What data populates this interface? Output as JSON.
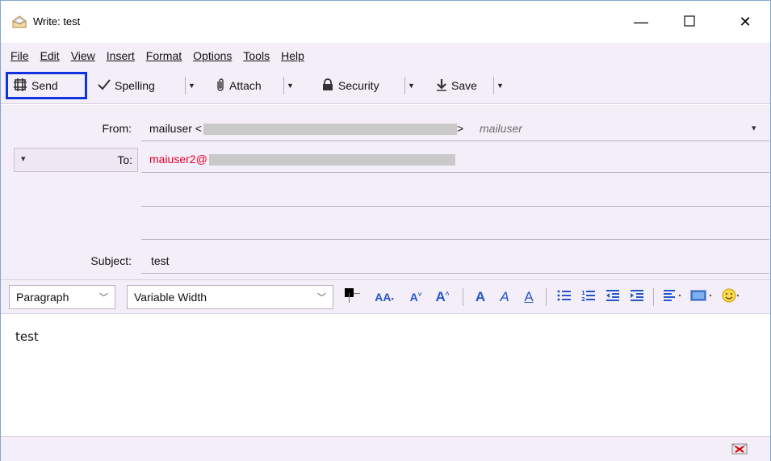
{
  "window": {
    "title": "Write: test",
    "min_glyph": "—",
    "max_glyph": "☐",
    "close_glyph": "✕"
  },
  "menu": [
    {
      "label": "File",
      "accel": "F"
    },
    {
      "label": "Edit",
      "accel": "E"
    },
    {
      "label": "View",
      "accel": "V"
    },
    {
      "label": "Insert",
      "accel": "I"
    },
    {
      "label": "Format",
      "accel": "o"
    },
    {
      "label": "Options",
      "accel": "p"
    },
    {
      "label": "Tools",
      "accel": "T"
    },
    {
      "label": "Help",
      "accel": "H"
    }
  ],
  "toolbar": {
    "send_label": "Send",
    "spelling_label": "Spelling",
    "attach_label": "Attach",
    "security_label": "Security",
    "save_label": "Save"
  },
  "header": {
    "from_label": "From:",
    "from_name": "mailuser <",
    "from_suffix": ">",
    "from_identity": "mailuser",
    "to_label": "To:",
    "to_value": "maiuser2@",
    "subject_label": "Subject:",
    "subject_value": "test"
  },
  "format": {
    "paragraph_value": "Paragraph",
    "font_value": "Variable Width"
  },
  "body": {
    "text": "test"
  },
  "colors": {
    "accent_send_border": "#1133dd",
    "recipient_text": "#e4002b",
    "chrome_bg": "#f4eef8",
    "format_icon_blue": "#2255cc"
  }
}
